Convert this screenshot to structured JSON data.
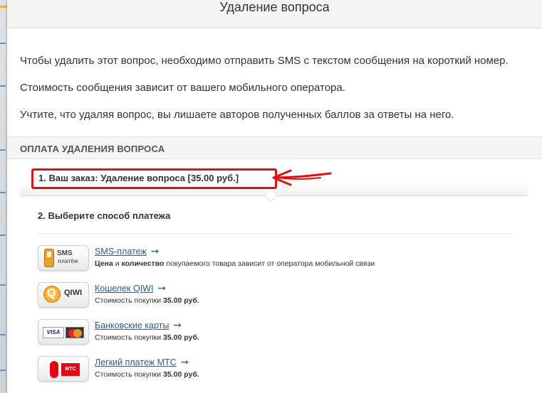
{
  "modal": {
    "title": "Удаление вопроса",
    "intro": [
      "Чтобы удалить этот вопрос, необходимо отправить SMS с текстом сообщения на короткий номер.",
      "Стоимость сообщения зависит от вашего мобильного оператора.",
      "Учтите, что удаляя вопрос, вы лишаете авторов полученных баллов за ответы на него."
    ]
  },
  "payment": {
    "section_title": "ОПЛАТА УДАЛЕНИЯ ВОПРОСА",
    "order_text": "1. Ваш заказ: Удаление вопроса [35.00 руб.]",
    "step2_title": "2. Выберите способ платежа",
    "arrow_glyph": "➙",
    "methods": [
      {
        "link": "SMS-платеж",
        "icon": "sms-phone-icon",
        "icon_text": "SMS",
        "icon_subtext": "платёж",
        "desc_parts": [
          "Цена",
          " и ",
          "количество",
          " покупаемого товара зависит от оператора мобильной связи"
        ]
      },
      {
        "link": "Кошелек QIWI",
        "icon": "qiwi-icon",
        "icon_text": "QIWI",
        "icon_letter": "Q",
        "desc_prefix": "Стоимость покупки ",
        "desc_price": "35.00 руб."
      },
      {
        "link": "Банковские карты",
        "icon": "bank-cards-icon",
        "icon_text": "VISA",
        "desc_prefix": "Стоимость покупки ",
        "desc_price": "35.00 руб."
      },
      {
        "link": "Легкий платеж МТС",
        "icon": "mts-icon",
        "icon_text": "МТС",
        "desc_prefix": "Стоимость покупки ",
        "desc_price": "35.00 руб."
      }
    ]
  },
  "colors": {
    "annotation": "#e01010",
    "link": "#1f5fa8",
    "header_bg": "#f4f4f4"
  }
}
